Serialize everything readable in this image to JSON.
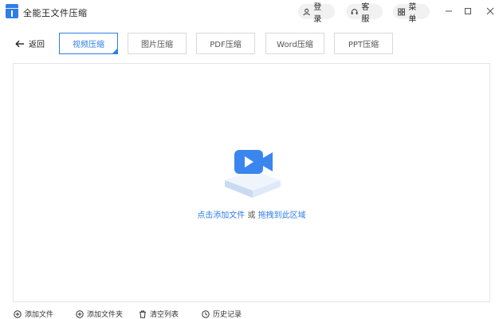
{
  "app": {
    "title": "全能王文件压缩"
  },
  "header": {
    "login_label": "登录",
    "service_label": "客服",
    "menu_label": "菜单"
  },
  "toolbar": {
    "back_label": "返回",
    "tabs": [
      {
        "label": "视频压缩",
        "active": true
      },
      {
        "label": "图片压缩",
        "active": false
      },
      {
        "label": "PDF压缩",
        "active": false
      },
      {
        "label": "Word压缩",
        "active": false
      },
      {
        "label": "PPT压缩",
        "active": false
      }
    ]
  },
  "dropzone": {
    "add_link": "点击添加文件",
    "or_text": "或",
    "drag_link": "拖拽到此区域"
  },
  "footer": {
    "actions": [
      {
        "label": "添加文件",
        "icon": "plus-circle-icon"
      },
      {
        "label": "添加文件夹",
        "icon": "plus-circle-icon"
      },
      {
        "label": "清空列表",
        "icon": "trash-icon"
      },
      {
        "label": "历史记录",
        "icon": "history-icon"
      }
    ]
  },
  "colors": {
    "accent": "#2f7ee6",
    "border": "#d9d9d9"
  }
}
